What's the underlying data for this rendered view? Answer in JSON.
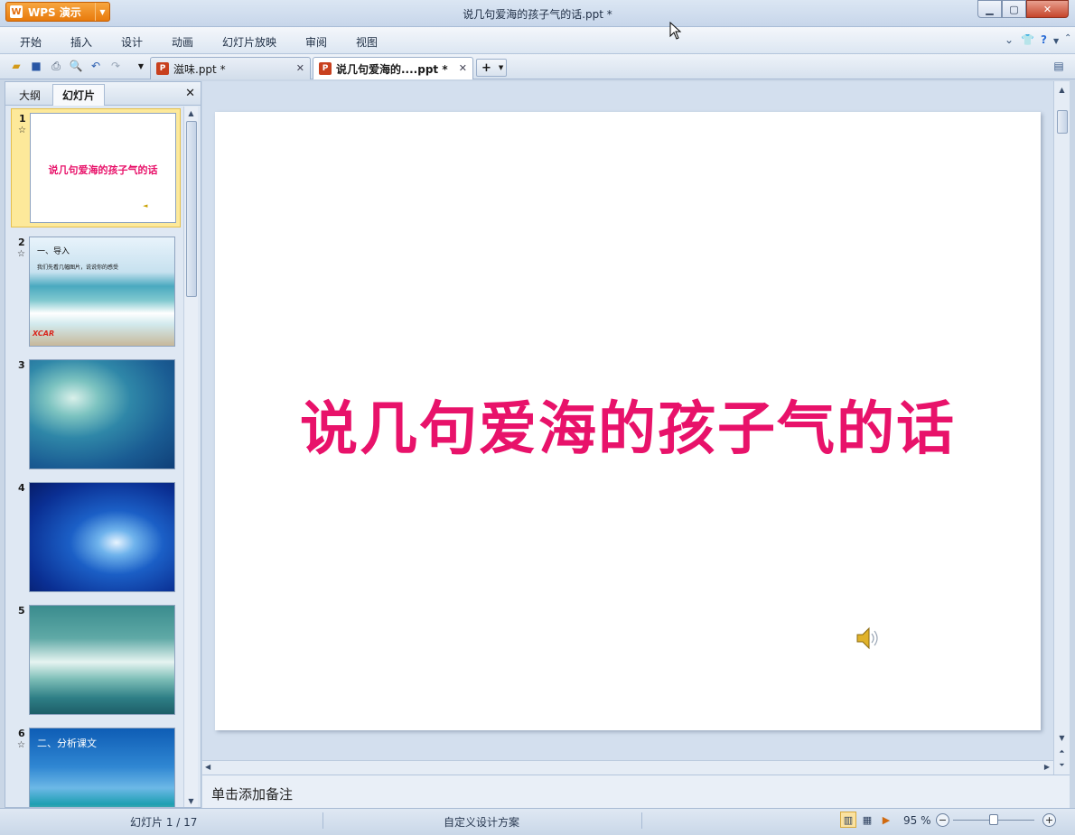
{
  "app": {
    "button_label": "WPS 演示",
    "window_title": "说几句爱海的孩子气的话.ppt *"
  },
  "menu": {
    "items": [
      "开始",
      "插入",
      "设计",
      "动画",
      "幻灯片放映",
      "审阅",
      "视图"
    ]
  },
  "tabs": [
    {
      "label": "滋味.ppt *",
      "active": false
    },
    {
      "label": "说几句爱海的....ppt *",
      "active": true
    }
  ],
  "panel": {
    "tab_outline": "大纲",
    "tab_slides": "幻灯片"
  },
  "thumbnails": [
    {
      "num": "1",
      "star": true,
      "title": "说几句爱海的孩子气的话",
      "selected": true
    },
    {
      "num": "2",
      "star": true,
      "heading": "一、导入",
      "bullet": "我们先看几幅图片，说说你的感受",
      "watermark": "XCAR"
    },
    {
      "num": "3",
      "star": false
    },
    {
      "num": "4",
      "star": false
    },
    {
      "num": "5",
      "star": false
    },
    {
      "num": "6",
      "star": true,
      "heading": "二、分析课文"
    }
  ],
  "slide": {
    "title": "说几句爱海的孩子气的话"
  },
  "notes": {
    "placeholder": "单击添加备注"
  },
  "status": {
    "slide_counter": "幻灯片 1 / 17",
    "design": "自定义设计方案",
    "zoom": "95 %"
  },
  "colors": {
    "title_pink": "#e8126a",
    "wps_orange": "#e87a0c"
  }
}
